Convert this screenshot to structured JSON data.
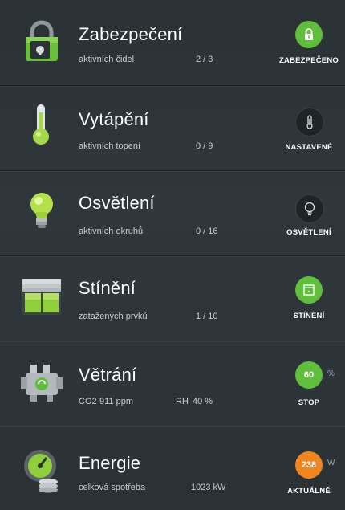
{
  "colors": {
    "green": "#5fbf3a",
    "dark_circle": "#1f2427",
    "orange": "#f0841e",
    "panel": "#2b3236"
  },
  "rows": [
    {
      "title": "Zabezpečení",
      "sub_label": "aktivních čidel",
      "value": "2 / 3",
      "state_label": "ZABEZPEČENO",
      "icon": "padlock-icon",
      "state_icon": "lock-icon"
    },
    {
      "title": "Vytápění",
      "sub_label": "aktivních topení",
      "value": "0 / 9",
      "state_label": "NASTAVENÉ",
      "icon": "thermometer-icon",
      "state_icon": "thermometer-icon"
    },
    {
      "title": "Osvětlení",
      "sub_label": "aktivních okruhů",
      "value": "0 / 16",
      "state_label": "OSVĚTLENÍ",
      "icon": "lightbulb-icon",
      "state_icon": "lightbulb-icon"
    },
    {
      "title": "Stínění",
      "sub_label": "zatažených prvků",
      "value": "1 / 10",
      "state_label": "STÍNĚNÍ",
      "icon": "blinds-icon",
      "state_icon": "window-icon"
    },
    {
      "title": "Větrání",
      "sub_label": "CO2",
      "value": "911 ppm",
      "extra_label": "RH",
      "extra_value": "40 %",
      "state_value": "60",
      "state_unit": "%",
      "state_label": "STOP",
      "icon": "ventilation-icon"
    },
    {
      "title": "Energie",
      "sub_label": "celková spotřeba",
      "value": "1023  kW",
      "state_value": "238",
      "state_unit": "W",
      "state_label": "AKTUÁLNĚ",
      "icon": "energy-meter-icon"
    }
  ]
}
